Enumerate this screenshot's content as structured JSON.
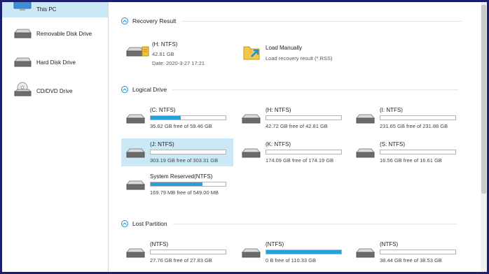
{
  "sidebar": {
    "items": [
      {
        "label": "This PC",
        "icon": "monitor-icon",
        "selected": true
      },
      {
        "label": "Removable Disk Drive",
        "icon": "removable-drive-icon"
      },
      {
        "label": "Hard Disk Drive",
        "icon": "hard-drive-icon"
      },
      {
        "label": "CD/DVD Drive",
        "icon": "cd-dvd-icon"
      }
    ]
  },
  "sections": {
    "recovery_result": {
      "title": "Recovery Result"
    },
    "logical_drive": {
      "title": "Logical Drive"
    },
    "lost_partition": {
      "title": "Lost Partition"
    }
  },
  "recovery": {
    "saved": {
      "name": "(H: NTFS)",
      "size": "42.81 GB",
      "date": "Date: 2020-3-27 17:21"
    },
    "load": {
      "title": "Load Manually",
      "subtitle": "Load recovery result (*.RSS)"
    }
  },
  "logical_drives": [
    {
      "name": "(C: NTFS)",
      "free": "35.62 GB free of 59.46 GB",
      "used_fraction": 0.4
    },
    {
      "name": "(H: NTFS)",
      "free": "42.72 GB free of 42.81 GB",
      "used_fraction": 0.0
    },
    {
      "name": "(I: NTFS)",
      "free": "231.65 GB free of 231.88 GB",
      "used_fraction": 0.0
    },
    {
      "name": "(J: NTFS)",
      "free": "303.19 GB free of 303.31 GB",
      "used_fraction": 0.0,
      "selected": true
    },
    {
      "name": "(K: NTFS)",
      "free": "174.09 GB free of 174.19 GB",
      "used_fraction": 0.0
    },
    {
      "name": "(S: NTFS)",
      "free": "16.56 GB free of 16.61 GB",
      "used_fraction": 0.0
    },
    {
      "name": "System Reserved(NTFS)",
      "free": "169.79 MB free of 549.00 MB",
      "used_fraction": 0.69
    }
  ],
  "lost_partitions": [
    {
      "name": "(NTFS)",
      "free": "27.76 GB free of 27.83 GB",
      "used_fraction": 0.0
    },
    {
      "name": "(NTFS)",
      "free": "0 B free of 110.33 GB",
      "used_fraction": 1.0
    },
    {
      "name": "(NTFS)",
      "free": "38.44 GB free of 38.53 GB",
      "used_fraction": 0.0
    }
  ],
  "colors": {
    "accent": "#26a0da",
    "selected_bg": "#cbe8f6",
    "frame": "#1b1f6e"
  }
}
